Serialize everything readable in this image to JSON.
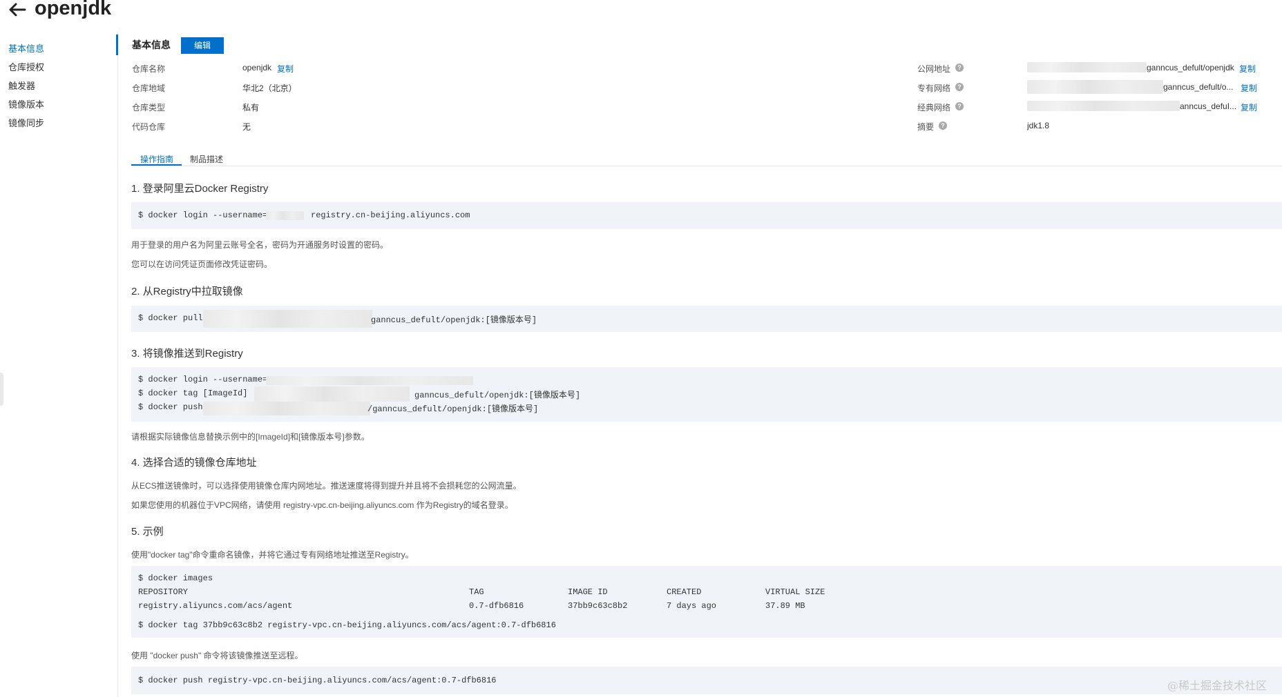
{
  "header": {
    "title": "openjdk"
  },
  "sidebar": {
    "items": [
      {
        "label": "基本信息",
        "active": true
      },
      {
        "label": "仓库授权",
        "active": false
      },
      {
        "label": "触发器",
        "active": false
      },
      {
        "label": "镜像版本",
        "active": false
      },
      {
        "label": "镜像同步",
        "active": false
      }
    ]
  },
  "basic": {
    "section_title": "基本信息",
    "edit_label": "编辑",
    "left": [
      {
        "label": "仓库名称",
        "value": "openjdk",
        "copy": "复制"
      },
      {
        "label": "仓库地域",
        "value": "华北2（北京）"
      },
      {
        "label": "仓库类型",
        "value": "私有"
      },
      {
        "label": "代码仓库",
        "value": "无"
      }
    ],
    "right": [
      {
        "label": "公网地址",
        "value": "ganncus_defult/openjdk",
        "copy": "复制"
      },
      {
        "label": "专有网络",
        "value": "ganncus_defult/o...",
        "copy": "复制"
      },
      {
        "label": "经典网络",
        "value": "anncus_defuI...",
        "copy": "复制"
      },
      {
        "label": "摘要",
        "value": "jdk1.8"
      }
    ]
  },
  "tabs": [
    {
      "label": "操作指南"
    },
    {
      "label": "制品描述"
    }
  ],
  "guide": {
    "s1": {
      "title": "1. 登录阿里云Docker Registry",
      "code1": "$ docker login --username=",
      "code2": "registry.cn-beijing.aliyuncs.com",
      "p1": "用于登录的用户名为阿里云账号全名，密码为开通服务时设置的密码。",
      "p2": "您可以在访问凭证页面修改凭证密码。"
    },
    "s2": {
      "title": "2. 从Registry中拉取镜像",
      "code1": "$ docker pull",
      "code2": "ganncus_defult/openjdk:[镜像版本号]"
    },
    "s3": {
      "title": "3. 将镜像推送到Registry",
      "l1": "$ docker login --username=",
      "l2a": "$ docker tag [ImageId]",
      "l2b": "ganncus_defult/openjdk:[镜像版本号]",
      "l3a": "$ docker push",
      "l3b": "/ganncus_defult/openjdk:[镜像版本号]",
      "p1": "请根据实际镜像信息替换示例中的[ImageId]和[镜像版本号]参数。"
    },
    "s4": {
      "title": "4. 选择合适的镜像仓库地址",
      "p1": "从ECS推送镜像时，可以选择使用镜像仓库内网地址。推送速度将得到提升并且将不会损耗您的公网流量。",
      "p2": "如果您使用的机器位于VPC网络，请使用 registry-vpc.cn-beijing.aliyuncs.com 作为Registry的域名登录。"
    },
    "s5": {
      "title": "5. 示例",
      "p1": "使用\"docker tag\"命令重命名镜像，并将它通过专有网络地址推送至Registry。",
      "cmd1": "$ docker images",
      "headers": [
        "REPOSITORY",
        "TAG",
        "IMAGE ID",
        "CREATED",
        "VIRTUAL SIZE"
      ],
      "row": [
        "registry.aliyuncs.com/acs/agent",
        "0.7-dfb6816",
        "37bb9c63c8b2",
        "7 days ago",
        "37.89 MB"
      ],
      "cmd2": "$ docker tag 37bb9c63c8b2 registry-vpc.cn-beijing.aliyuncs.com/acs/agent:0.7-dfb6816",
      "p2": "使用 \"docker push\" 命令将该镜像推送至远程。",
      "cmd3": "$ docker push registry-vpc.cn-beijing.aliyuncs.com/acs/agent:0.7-dfb6816"
    }
  },
  "watermark": "@稀土掘金技术社区"
}
